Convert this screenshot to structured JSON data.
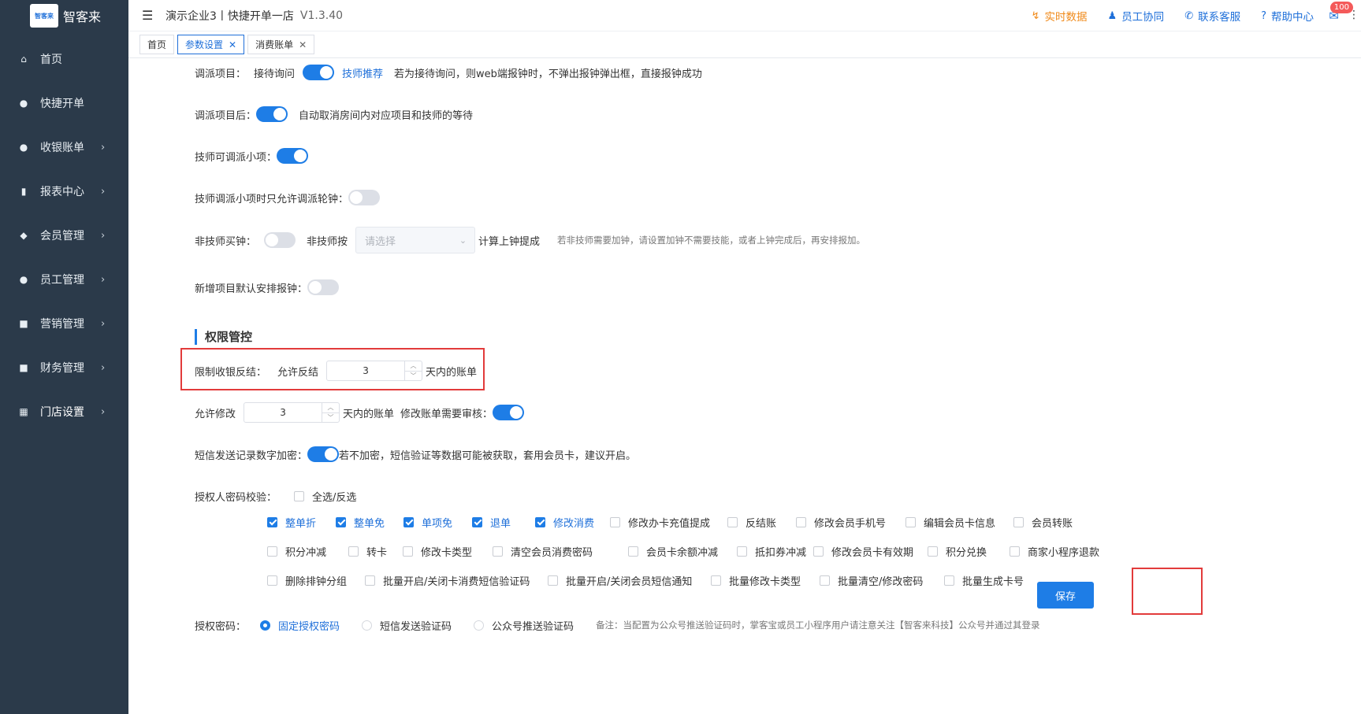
{
  "logo": {
    "box_text": "智客来",
    "text": "智客来"
  },
  "sidebar": {
    "items": [
      {
        "label": "首页",
        "icon": "dashboard-icon",
        "glyph": "⌂",
        "chevron": false
      },
      {
        "label": "快捷开单",
        "icon": "moneybag-icon",
        "glyph": "●",
        "chevron": false
      },
      {
        "label": "收银账单",
        "icon": "moneybag-icon",
        "glyph": "●",
        "chevron": true
      },
      {
        "label": "报表中心",
        "icon": "bar-chart-icon",
        "glyph": "▮",
        "chevron": true
      },
      {
        "label": "会员管理",
        "icon": "diamond-icon",
        "glyph": "◆",
        "chevron": true
      },
      {
        "label": "员工管理",
        "icon": "user-icon",
        "glyph": "●",
        "chevron": true
      },
      {
        "label": "营销管理",
        "icon": "briefcase-icon",
        "glyph": "■",
        "chevron": true
      },
      {
        "label": "财务管理",
        "icon": "wallet-icon",
        "glyph": "■",
        "chevron": true
      },
      {
        "label": "门店设置",
        "icon": "grid-icon",
        "glyph": "▦",
        "chevron": true
      }
    ],
    "chevron_glyph": "›"
  },
  "topbar": {
    "brand": "演示企业3丨快捷开单一店",
    "version": "V1.3.40",
    "links": [
      {
        "label": "实时数据",
        "icon": "realtime-icon",
        "glyph": "↯",
        "color": "#f08a1a"
      },
      {
        "label": "员工协同",
        "icon": "team-icon",
        "glyph": "♟",
        "color": "#1e6fd9"
      },
      {
        "label": "联系客服",
        "icon": "phone-icon",
        "glyph": "✆",
        "color": "#1e6fd9"
      },
      {
        "label": "帮助中心",
        "icon": "help-icon",
        "glyph": "?",
        "color": "#1e6fd9"
      }
    ],
    "mail_badge": "100"
  },
  "tabs": [
    {
      "label": "首页",
      "closable": false,
      "active": false
    },
    {
      "label": "参数设置",
      "closable": true,
      "active": true
    },
    {
      "label": "消费账单",
      "closable": true,
      "active": false
    }
  ],
  "settings": {
    "dispatch": {
      "label": "调派项目：",
      "option_a": "接待询问",
      "option_b": "技师推荐",
      "hint": "若为接待询问，则web端报钟时，不弹出报钟弹出框，直接报钟成功",
      "on": true
    },
    "after_dispatch": {
      "label": "调派项目后：",
      "hint": "自动取消房间内对应项目和技师的等待",
      "on": true
    },
    "tech_sub": {
      "label": "技师可调派小项：",
      "on": true
    },
    "tech_sub_only": {
      "label": "技师调派小项时只允许调派轮钟：",
      "on": false
    },
    "non_tech": {
      "label": "非技师买钟：",
      "by_label": "非技师按",
      "select_placeholder": "请选择",
      "after": "计算上钟提成",
      "hint": "若非技师需要加钟，请设置加钟不需要技能，或者上钟完成后，再安排报加。",
      "on": false
    },
    "new_item": {
      "label": "新增项目默认安排报钟：",
      "on": false
    }
  },
  "permission": {
    "title": "权限管控",
    "limit_unsettle": {
      "label": "限制收银反结：",
      "allow": "允许反结",
      "value": "3",
      "suffix": "天内的账单"
    },
    "allow_edit": {
      "label": "允许修改",
      "value": "3",
      "suffix": "天内的账单",
      "review_label": "修改账单需要审核：",
      "on": true
    },
    "sms_encrypt": {
      "label": "短信发送记录数字加密：",
      "hint": "若不加密，短信验证等数据可能被获取，套用会员卡，建议开启。",
      "on": true
    },
    "auth_check": {
      "label": "授权人密码校验：",
      "select_all": "全选/反选"
    },
    "checkbox_rows": [
      [
        {
          "label": "整单折",
          "checked": true
        },
        {
          "label": "整单免",
          "checked": true
        },
        {
          "label": "单项免",
          "checked": true
        },
        {
          "label": "退单",
          "checked": true
        },
        {
          "label": "修改消费",
          "checked": true
        },
        {
          "label": "修改办卡充值提成",
          "checked": false
        },
        {
          "label": "反结账",
          "checked": false
        },
        {
          "label": "修改会员手机号",
          "checked": false
        },
        {
          "label": "编辑会员卡信息",
          "checked": false
        },
        {
          "label": "会员转账",
          "checked": false
        }
      ],
      [
        {
          "label": "积分冲减",
          "checked": false
        },
        {
          "label": "转卡",
          "checked": false
        },
        {
          "label": "修改卡类型",
          "checked": false
        },
        {
          "label": "清空会员消费密码",
          "checked": false
        },
        {
          "label": "会员卡余额冲减",
          "checked": false
        },
        {
          "label": "抵扣券冲减",
          "checked": false
        },
        {
          "label": "修改会员卡有效期",
          "checked": false
        },
        {
          "label": "积分兑换",
          "checked": false
        },
        {
          "label": "商家小程序退款",
          "checked": false
        }
      ],
      [
        {
          "label": "删除排钟分组",
          "checked": false
        },
        {
          "label": "批量开启/关闭卡消费短信验证码",
          "checked": false
        },
        {
          "label": "批量开启/关闭会员短信通知",
          "checked": false
        },
        {
          "label": "批量修改卡类型",
          "checked": false
        },
        {
          "label": "批量清空/修改密码",
          "checked": false
        },
        {
          "label": "批量生成卡号",
          "checked": false
        }
      ]
    ],
    "save_label": "保存",
    "auth_password": {
      "label": "授权密码：",
      "options": [
        {
          "label": "固定授权密码",
          "selected": true
        },
        {
          "label": "短信发送验证码",
          "selected": false
        },
        {
          "label": "公众号推送验证码",
          "selected": false
        }
      ],
      "note": "备注：当配置为公众号推送验证码时，掌客宝或员工小程序用户请注意关注【智客来科技】公众号并通过其登录"
    }
  }
}
